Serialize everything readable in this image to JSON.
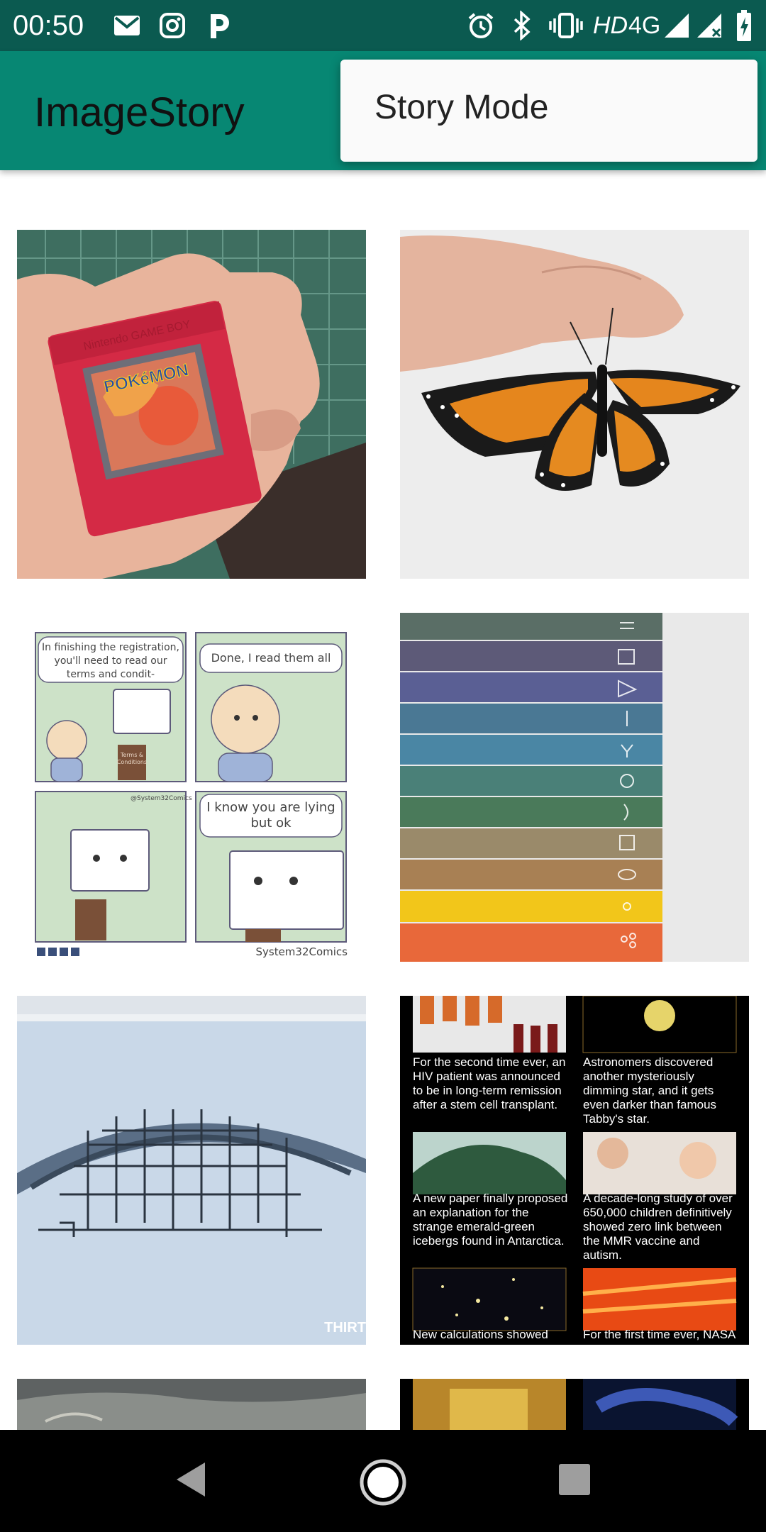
{
  "status_bar": {
    "time": "00:50",
    "network": "HD",
    "network_type": "4G",
    "notification_icons": [
      "gmail-icon",
      "instagram-icon",
      "pandora-icon"
    ],
    "system_icons": [
      "alarm-icon",
      "bluetooth-icon",
      "vibrate-icon",
      "signal-icon",
      "signal-no-sim-icon",
      "battery-icon"
    ]
  },
  "app_bar": {
    "title": "ImageStory"
  },
  "overflow_menu": {
    "items": [
      "Story Mode"
    ]
  },
  "comic": {
    "bubble1": "In finishing the registration, you'll need to read our terms and condit-",
    "bubble2": "Done, I read them all",
    "bubble3": "I know you are lying but ok",
    "credit_small": "@System32Comics",
    "credit": "System32Comics",
    "book_label": "Terms & Conditions"
  },
  "news_tile": {
    "captions": [
      "For the second time ever, an HIV patient was announced to be in long-term remission after a stem cell transplant.",
      "Astronomers discovered another mysteriously dimming star, and it gets even darker than famous Tabby's star.",
      "A new paper finally proposed an explanation for the strange emerald-green icebergs found in Antarctica.",
      "A decade-long study of over 650,000 children definitively showed zero link between the MMR vaccine and autism.",
      "New calculations showed",
      "For the first time ever, NASA"
    ]
  },
  "cartridge": {
    "brand": "Nintendo GAME BOY",
    "game": "POKéMON"
  },
  "video_watermark": "THIRT",
  "colors": {
    "status_bar": "#0b5a50",
    "app_bar": "#078773",
    "popup": "#fafafa"
  }
}
